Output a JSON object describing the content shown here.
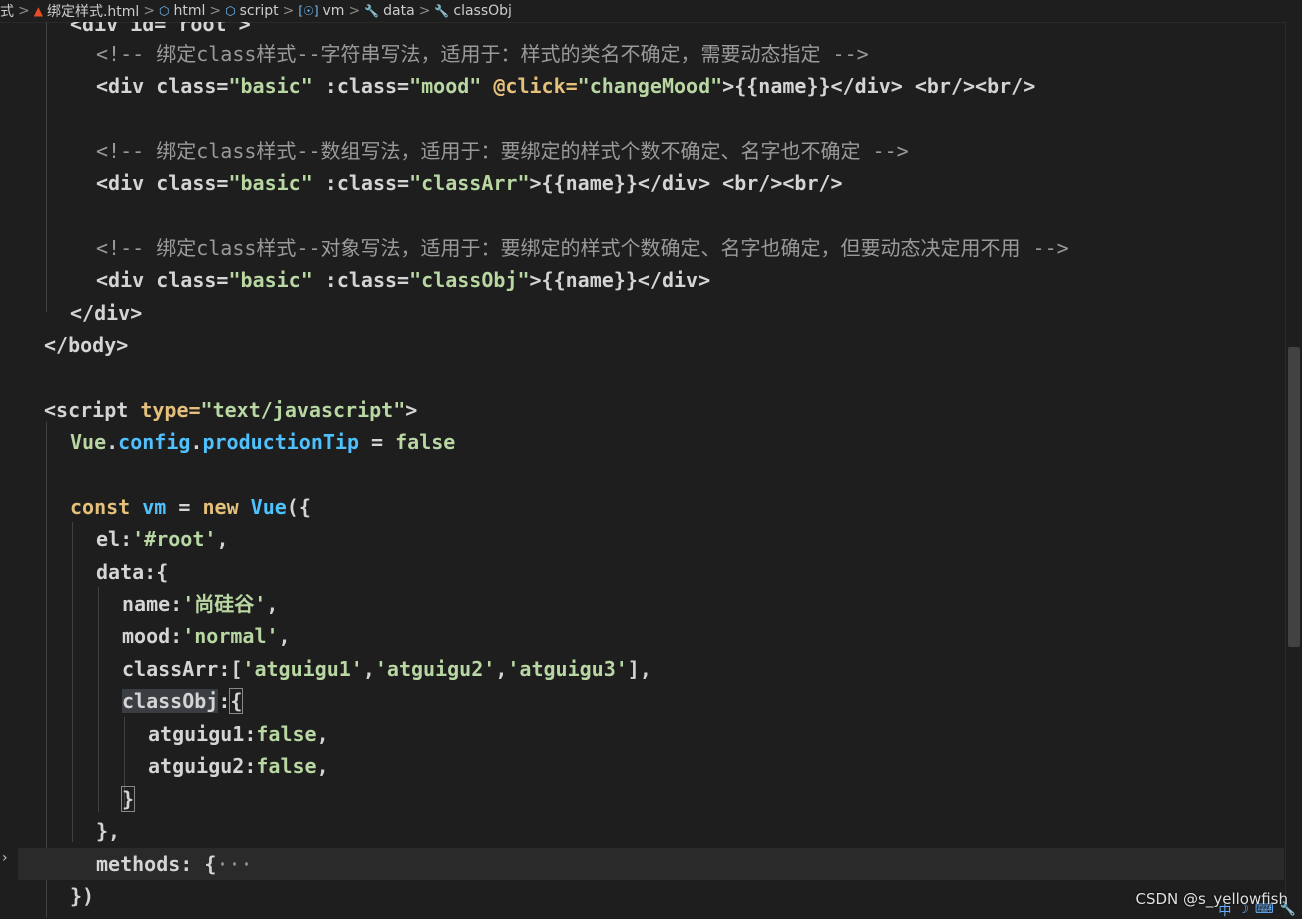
{
  "breadcrumb": {
    "items": [
      {
        "icon": "file-tail",
        "label": "式"
      },
      {
        "icon": "html5-icon",
        "label": "绑定样式.html"
      },
      {
        "icon": "cube-icon",
        "label": "html"
      },
      {
        "icon": "cube-icon",
        "label": "script"
      },
      {
        "icon": "variable-icon",
        "label": "vm"
      },
      {
        "icon": "wrench-icon",
        "label": "data"
      },
      {
        "icon": "wrench-icon",
        "label": "classObj"
      }
    ],
    "separator": ">"
  },
  "code": {
    "l0": "<div id=\"root\">",
    "l1_comment": "<!-- 绑定class样式--字符串写法，适用于：样式的类名不确定，需要动态指定 -->",
    "l2": [
      "<div",
      " class=",
      "\"basic\"",
      " :class=",
      "\"mood\"",
      " @click=",
      "\"changeMood\"",
      ">{{name}}</div> <br/><br/>"
    ],
    "l4_comment": "<!-- 绑定class样式--数组写法，适用于：要绑定的样式个数不确定、名字也不确定 -->",
    "l5": [
      "<div",
      " class=",
      "\"basic\"",
      " :class=",
      "\"classArr\"",
      ">{{name}}</div> <br/><br/>"
    ],
    "l7_comment": "<!-- 绑定class样式--对象写法，适用于：要绑定的样式个数确定、名字也确定，但要动态决定用不用 -->",
    "l8": [
      "<div",
      " class=",
      "\"basic\"",
      " :class=",
      "\"classObj\"",
      ">{{name}}</div>"
    ],
    "l9": "</div>",
    "l10": "</body>",
    "l12": [
      "<script",
      " type=",
      "\"text/javascript\"",
      ">"
    ],
    "l13": [
      "Vue",
      ".",
      "config",
      ".",
      "productionTip",
      " = ",
      "false"
    ],
    "l15": [
      "const",
      " vm ",
      "= ",
      "new",
      " Vue",
      "({"
    ],
    "l16": [
      "el",
      ":",
      "'#root'",
      ","
    ],
    "l17": [
      "data",
      ":{"
    ],
    "l18": [
      "name",
      ":",
      "'尚硅谷'",
      ","
    ],
    "l19": [
      "mood",
      ":",
      "'normal'",
      ","
    ],
    "l20": [
      "classArr",
      ":[",
      "'atguigu1'",
      ",",
      "'atguigu2'",
      ",",
      "'atguigu3'",
      "],"
    ],
    "l21": [
      "classObj",
      ":",
      "{"
    ],
    "l22": [
      "atguigu1",
      ":",
      "false",
      ","
    ],
    "l23": [
      "atguigu2",
      ":",
      "false",
      ","
    ],
    "l24": "}",
    "l25": "},",
    "l26": [
      "methods",
      ": ",
      "{",
      "···"
    ],
    "l27": "})"
  },
  "watermark": "CSDN @s_yellowfish",
  "tray": [
    "中",
    "☽",
    "⌨",
    "🔧"
  ]
}
